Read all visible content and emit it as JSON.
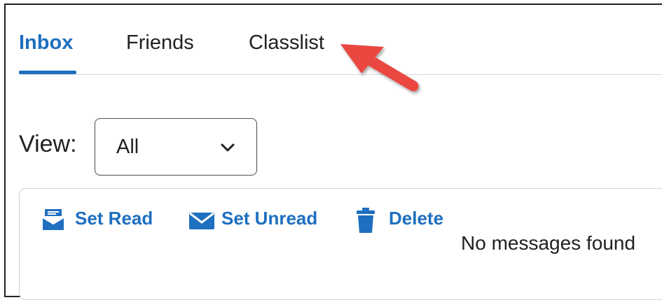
{
  "tabs": [
    {
      "label": "Inbox",
      "active": true
    },
    {
      "label": "Friends",
      "active": false
    },
    {
      "label": "Classlist",
      "active": false
    }
  ],
  "view": {
    "label": "View:",
    "selected": "All"
  },
  "toolbar": {
    "set_read": "Set Read",
    "set_unread": "Set Unread",
    "delete": "Delete"
  },
  "messages": {
    "empty_text": "No messages found"
  },
  "colors": {
    "accent": "#1e6fbf",
    "annotation_arrow": "#e9473f",
    "text": "#202122"
  },
  "icons": {
    "set_read": "envelope-open-icon",
    "set_unread": "envelope-icon",
    "delete": "trash-icon",
    "dropdown": "chevron-down-icon",
    "annotation": "arrow-pointer-icon"
  }
}
